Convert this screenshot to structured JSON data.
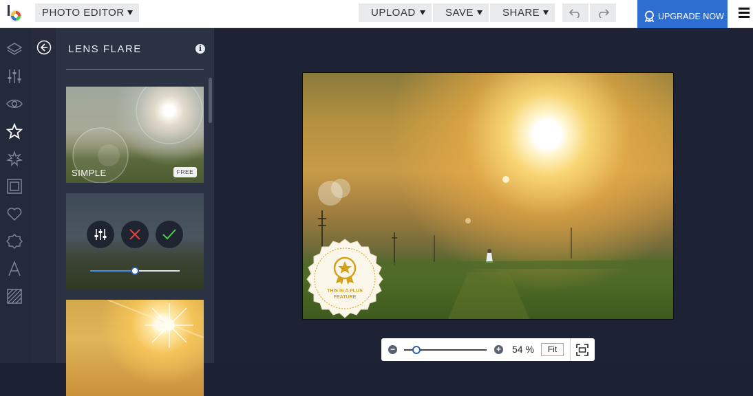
{
  "header": {
    "app_title": "PHOTO EDITOR",
    "upload_label": "UPLOAD",
    "save_label": "SAVE",
    "share_label": "SHARE",
    "upgrade_label": "UPGRADE NOW"
  },
  "rail": {
    "items": [
      {
        "icon": "layers-icon"
      },
      {
        "icon": "adjustments-icon"
      },
      {
        "icon": "eye-icon"
      },
      {
        "icon": "star-icon"
      },
      {
        "icon": "sparkle-icon"
      },
      {
        "icon": "frame-icon"
      },
      {
        "icon": "heart-icon"
      },
      {
        "icon": "badge-icon"
      },
      {
        "icon": "text-icon"
      },
      {
        "icon": "texture-icon"
      }
    ]
  },
  "panel": {
    "title": "LENS FLARE",
    "effects": [
      {
        "label": "SIMPLE",
        "badge": "FREE"
      },
      {
        "label": "",
        "intensity": 0.5
      },
      {
        "label": ""
      }
    ]
  },
  "canvas": {
    "plus_seal_text_line1": "THIS IS A PLUS",
    "plus_seal_text_line2": "FEATURE"
  },
  "zoom": {
    "value_label": "54 %",
    "level": 0.15,
    "fit_label": "Fit"
  },
  "colors": {
    "accent": "#2f6ed1",
    "cancel": "#e0443a",
    "apply": "#4ec94e",
    "seal": "#d4a11a"
  }
}
